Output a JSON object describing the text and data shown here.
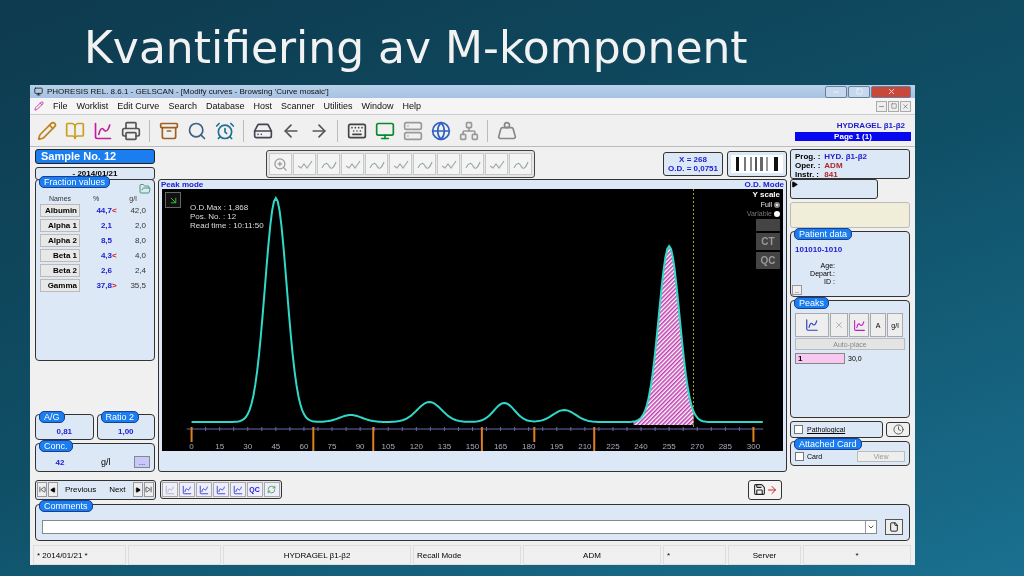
{
  "slide_title": "Kvantifiering av M-komponent",
  "window": {
    "title": "PHORESIS REL. 8.6.1 - GELSCAN - [Modify curves - Browsing 'Curve mosaic']"
  },
  "menu": [
    "File",
    "Worklist",
    "Edit Curve",
    "Search",
    "Database",
    "Host",
    "Scanner",
    "Utilities",
    "Window",
    "Help"
  ],
  "gel_name": "HYDRAGEL β1-β2",
  "page": "Page 1 (1)",
  "sample": {
    "title": "Sample No.  12",
    "date": "- 2014/01/21"
  },
  "readout": {
    "x": "X = 268",
    "od": "O.D. = 0,0751"
  },
  "info": [
    {
      "label": "Prog. :",
      "value": "HYD. β1-β2",
      "color": "#2020d0"
    },
    {
      "label": "Oper. :",
      "value": "ADM",
      "color": "#b02828"
    },
    {
      "label": "Instr. :",
      "value": "841",
      "color": "#b02828"
    }
  ],
  "fractions": {
    "title": "Fraction values",
    "headers": [
      "Names",
      "%",
      "g/l"
    ],
    "rows": [
      {
        "name": "Albumin",
        "percent": "44,7",
        "flag": "<",
        "gl": "42,0"
      },
      {
        "name": "Alpha 1",
        "percent": "2,1",
        "gl": "2,0"
      },
      {
        "name": "Alpha 2",
        "percent": "8,5",
        "gl": "8,0"
      },
      {
        "name": "Beta 1",
        "percent": "4,3",
        "flag": "<",
        "gl": "4,0"
      },
      {
        "name": "Beta 2",
        "percent": "2,6",
        "gl": "2,4"
      },
      {
        "name": "Gamma",
        "percent": "37,8",
        "flag": ">",
        "gl": "35,5"
      }
    ]
  },
  "ag": {
    "label": "A/G",
    "value": "0,81"
  },
  "ratio": {
    "label": "Ratio 2",
    "value": "1,00"
  },
  "conc": {
    "label": "Conc.",
    "value": "42",
    "unit": "g/l",
    "button": "..."
  },
  "chart": {
    "mode": "Peak mode",
    "od_mode": "O.D. Mode",
    "y_scale": "Y scale",
    "options": [
      {
        "label": "Full",
        "selected": true
      },
      {
        "label": "Variable",
        "selected": false
      }
    ],
    "ct": "CT",
    "qc": "QC",
    "info": [
      "O.D.Max : 1,868",
      "Pos. No. : 12",
      "Read time : 10:11:50"
    ],
    "ticks": [
      "0",
      "15",
      "30",
      "45",
      "60",
      "75",
      "90",
      "105",
      "120",
      "135",
      "150",
      "165",
      "180",
      "195",
      "210",
      "225",
      "240",
      "255",
      "270",
      "285",
      "300"
    ]
  },
  "patient": {
    "title": "Patient data",
    "id": "101010-1010",
    "fields": [
      "Age:",
      "Depart.:",
      "ID :"
    ],
    "button": ".."
  },
  "peaks": {
    "title": "Peaks",
    "tabs": [
      "A",
      "g/l"
    ],
    "auto_place": "Auto-place",
    "entries": [
      {
        "number": "1",
        "value": "30,0"
      }
    ]
  },
  "pathological": {
    "label": "Pathological",
    "checked": false
  },
  "attached_card": {
    "title": "Attached Card",
    "label": "Card",
    "checked": false,
    "button": "View"
  },
  "nav": {
    "previous": "Previous",
    "next": "Next"
  },
  "qc_button": "QC",
  "comments": {
    "title": "Comments"
  },
  "status": [
    "* 2014/01/21 *",
    "HYDRAGEL β1-β2",
    "Recall Mode",
    "ADM",
    "*",
    "Server",
    "*"
  ]
}
